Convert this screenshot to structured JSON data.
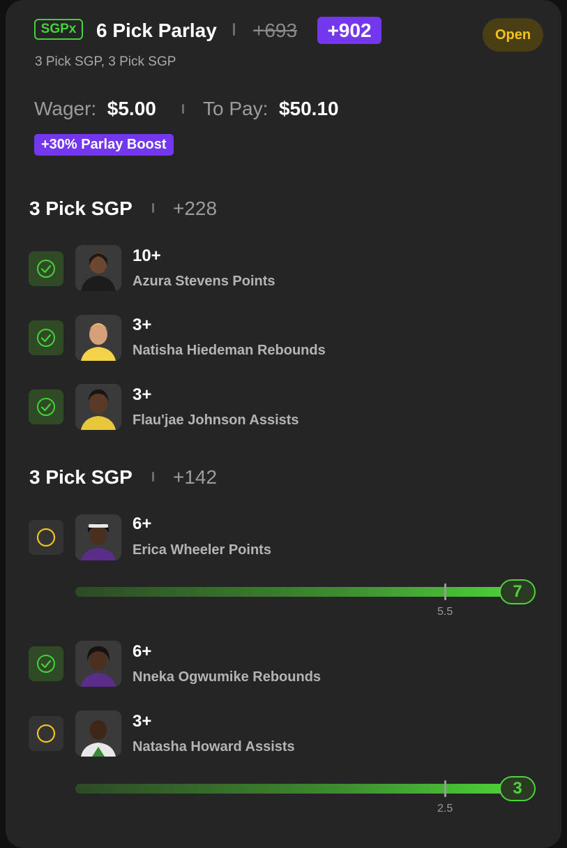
{
  "header": {
    "badge": "SGPx",
    "title": "6 Pick Parlay",
    "old_odds": "+693",
    "new_odds": "+902",
    "status": "Open",
    "subtitle": "3 Pick SGP, 3 Pick SGP"
  },
  "wager": {
    "wager_label": "Wager:",
    "wager_value": "$5.00",
    "pay_label": "To Pay:",
    "pay_value": "$50.10",
    "boost": "+30% Parlay Boost"
  },
  "sections": [
    {
      "title": "3 Pick SGP",
      "odds": "+228",
      "picks": [
        {
          "line": "10+",
          "description": "Azura Stevens Points",
          "status": "won",
          "icon": "check-circle-icon"
        },
        {
          "line": "3+",
          "description": "Natisha Hiedeman Rebounds",
          "status": "won",
          "icon": "check-circle-icon"
        },
        {
          "line": "3+",
          "description": "Flau'jae Johnson Assists",
          "status": "won",
          "icon": "check-circle-icon"
        }
      ]
    },
    {
      "title": "3 Pick SGP",
      "odds": "+142",
      "picks": [
        {
          "line": "6+",
          "description": "Erica Wheeler Points",
          "status": "pending",
          "icon": "pending-circle-icon",
          "progress": {
            "current": "7",
            "threshold": "5.5"
          }
        },
        {
          "line": "6+",
          "description": "Nneka Ogwumike Rebounds",
          "status": "won",
          "icon": "check-circle-icon"
        },
        {
          "line": "3+",
          "description": "Natasha Howard Assists",
          "status": "pending",
          "icon": "pending-circle-icon",
          "progress": {
            "current": "3",
            "threshold": "2.5"
          }
        }
      ]
    }
  ],
  "colors": {
    "accent_green": "#44d23a",
    "accent_purple": "#7338ee",
    "pending_yellow": "#f1c31c",
    "card_bg": "#252525"
  }
}
